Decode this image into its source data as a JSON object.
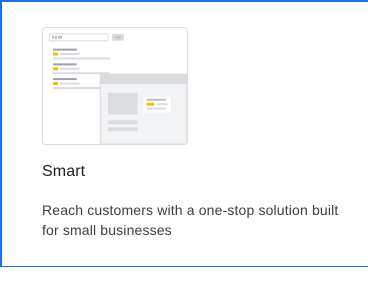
{
  "card": {
    "title": "Smart",
    "description": "Reach customers with a one-stop solution built for small businesses"
  },
  "colors": {
    "selected_border": "#1a73e8",
    "accent_yellow": "#fbbc04",
    "placeholder_gray": "#dadce0"
  },
  "icons": {
    "search_result_mock": "search-results-illustration",
    "listing_panel": "map-listing-illustration"
  }
}
